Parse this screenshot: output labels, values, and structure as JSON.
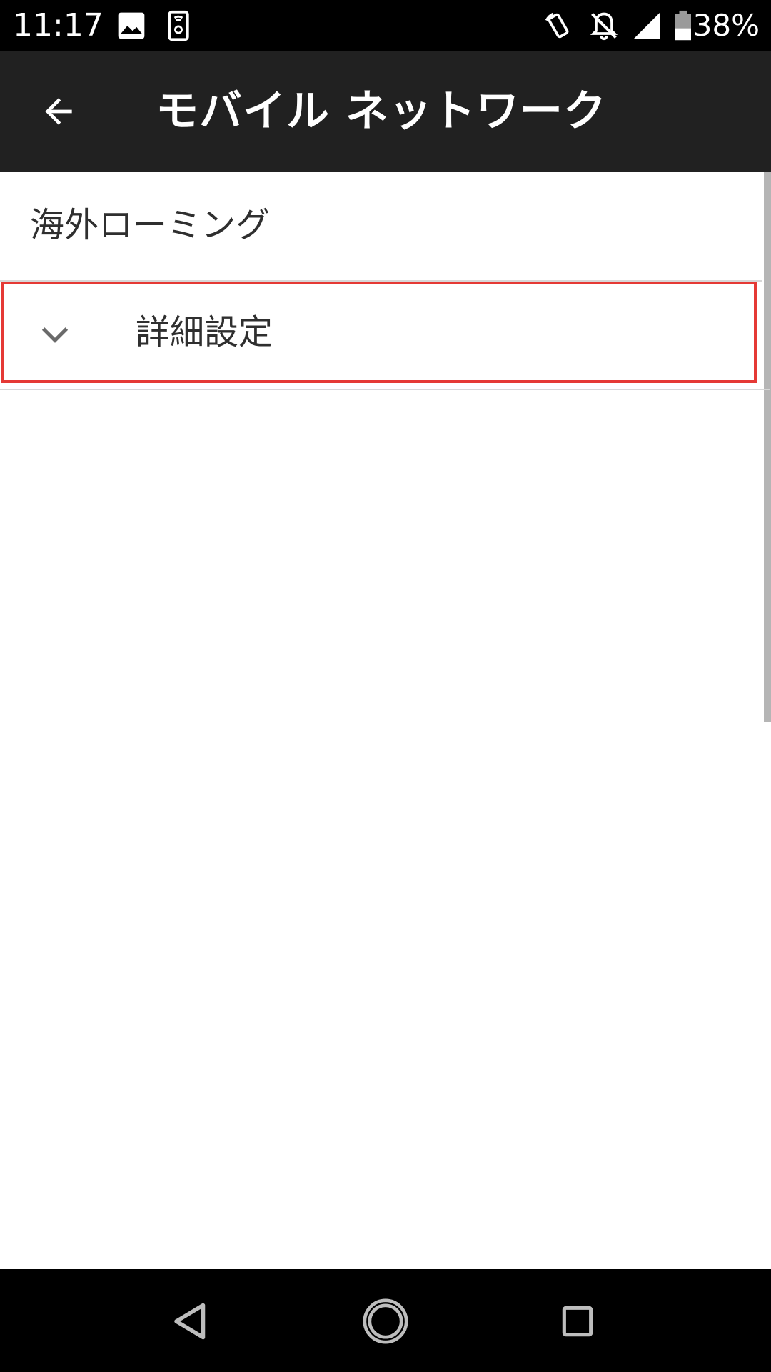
{
  "status_bar": {
    "time": "11:17",
    "battery_percent": "38%",
    "icons": [
      "image-icon",
      "phone-settings-icon",
      "rotate-icon",
      "bell-off-icon",
      "signal-icon",
      "battery-icon"
    ]
  },
  "app_bar": {
    "title": "モバイル ネットワーク",
    "back_icon": "arrow-left-icon"
  },
  "content": {
    "items": [
      {
        "title": "海外ローミング"
      },
      {
        "title": "詳細設定",
        "icon": "chevron-down-icon",
        "highlighted": true
      }
    ]
  },
  "nav_bar": {
    "buttons": [
      "back-triangle-icon",
      "home-circle-icon",
      "recents-square-icon"
    ]
  },
  "colors": {
    "status_bar": "#000000",
    "app_bar": "#212121",
    "highlight": "#e53935",
    "text": "#2f2f2f"
  }
}
